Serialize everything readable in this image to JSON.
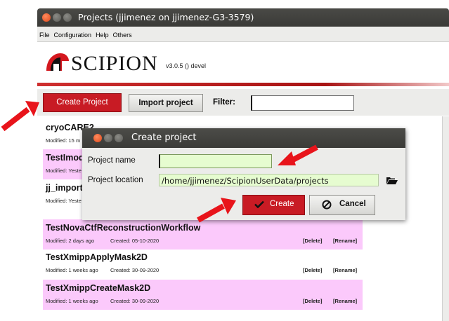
{
  "window": {
    "title": "Projects (jjimenez on jjimenez-G3-3579)"
  },
  "menu": [
    "File",
    "Configuration",
    "Help",
    "Others"
  ],
  "header": {
    "logo_text": "SCIPION",
    "version": "v3.0.5 () devel"
  },
  "toolbar": {
    "create_label": "Create Project",
    "import_label": "Import project",
    "filter_label": "Filter:",
    "filter_value": ""
  },
  "projects": [
    {
      "name": "cryoCARE2",
      "modified": "Modified: 15 m",
      "created": ""
    },
    {
      "name": "TestImod",
      "modified": "Modified: Yeste",
      "created": ""
    },
    {
      "name": "jj_importT",
      "modified": "Modified: Yeste",
      "created": ""
    },
    {
      "name": "TestNovaCtfReconstructionWorkflow",
      "modified": "Modified: 2 days ago",
      "created": "Created: 05-10-2020",
      "delete": "[Delete]",
      "rename": "[Rename]"
    },
    {
      "name": "TestXmippApplyMask2D",
      "modified": "Modified: 1 weeks ago",
      "created": "Created: 30-09-2020",
      "delete": "[Delete]",
      "rename": "[Rename]"
    },
    {
      "name": "TestXmippCreateMask2D",
      "modified": "Modified: 1 weeks ago",
      "created": "Created: 30-09-2020",
      "delete": "[Delete]",
      "rename": "[Rename]"
    }
  ],
  "dialog": {
    "title": "Create project",
    "name_label": "Project  name",
    "name_value": "",
    "location_label": "Project  location",
    "location_value": "/home/jjimenez/ScipionUserData/projects",
    "create_label": "Create",
    "cancel_label": "Cancel"
  },
  "colors": {
    "accent_red": "#c81b24",
    "highlight_pink": "#fbc9fb",
    "input_green": "#e6fcd0",
    "titlebar": "#3c3b37"
  },
  "icons": [
    "close-icon",
    "minimize-icon",
    "maximize-icon",
    "scipion-helmet-icon",
    "folder-open-icon",
    "checkmark-icon",
    "cancel-icon",
    "red-arrow-annotation"
  ]
}
